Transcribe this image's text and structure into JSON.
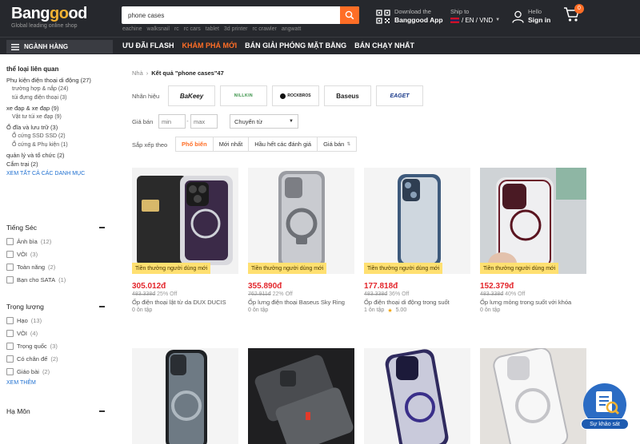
{
  "header": {
    "logo_main_a": "Bang",
    "logo_main_b": "go",
    "logo_main_c": "od",
    "logo_tagline": "Global leading online shop",
    "search_value": "phone cases",
    "hot_words": [
      "eachine",
      "walksnail",
      "rc",
      "rc cars",
      "tablet",
      "3d printer",
      "rc crawler",
      "angwatt"
    ],
    "app_line1": "Download the",
    "app_line2": "Banggood App",
    "ship_label": "Ship to",
    "ship_value": "/ EN / VND",
    "user_line1": "Hello",
    "user_line2": "Sign in",
    "cart_count": "0"
  },
  "nav": {
    "categories_label": "NGÀNH HÀNG",
    "links": [
      "ƯU ĐÃI FLASH",
      "KHÁM PHÁ MỚI",
      "BÁN GIẢI PHÓNG MẶT BẰNG",
      "BÁN CHẠY NHẤT"
    ]
  },
  "sidebar": {
    "related_title": "thể loại liên quan",
    "cat1": "Phụ kiện điện thoại di động (27)",
    "cat1_sub1": "trường hợp & nắp (24)",
    "cat1_sub2": "túi đựng điện thoại (3)",
    "cat2": "xe đạp & xe đạp (9)",
    "cat2_sub1": "Vật tư túi xe đạp (9)",
    "cat3": "Ổ đĩa và lưu trữ (3)",
    "cat3_sub1": "Ổ cứng SSD SSD (2)",
    "cat3_sub2": "Ổ cứng & Phụ kiện (1)",
    "cat4": "quản lý và tổ chức (2)",
    "cat5": "Cắm trại (2)",
    "see_all": "XEM TẤT CẢ CÁC DANH MỤC",
    "facet1_title": "Tiếng Séc",
    "facet1_items": [
      {
        "label": "Ảnh bìa",
        "count": "(12)"
      },
      {
        "label": "VÒI",
        "count": "(3)"
      },
      {
        "label": "Toàn năng",
        "count": "(2)"
      },
      {
        "label": "Bạn cho SATA",
        "count": "(1)"
      }
    ],
    "facet2_title": "Trọng lượng",
    "facet2_items": [
      {
        "label": "Hạo",
        "count": "(13)"
      },
      {
        "label": "VÒI",
        "count": "(4)"
      },
      {
        "label": "Trọng quốc",
        "count": "(3)"
      },
      {
        "label": "Có chân đế",
        "count": "(2)"
      },
      {
        "label": "Giáo bài",
        "count": "(2)"
      }
    ],
    "see_more": "XEM THÊM",
    "facet3_title": "Hạ Môn"
  },
  "main": {
    "crumb_home": "Nhà",
    "crumb_sep": "›",
    "crumb_current": "Kết quả \"phone cases\"47",
    "brand_label": "Nhãn hiệu",
    "brands": [
      "BaKeey",
      "NILLKIN",
      "ROCKBROS",
      "Baseus",
      "EAGET"
    ],
    "price_label": "Giá bán",
    "price_min_ph": "min",
    "price_max_ph": "max",
    "price_dash": "-",
    "convert_label": "Chuyển từ",
    "sort_label": "Sắp xếp theo",
    "sort_options": [
      "Phổ biến",
      "Mới nhất",
      "Hầu hết các đánh giá",
      "Giá bán"
    ]
  },
  "products": [
    {
      "promo": "Tiền thưởng người dùng mới",
      "price": "305.012đ",
      "old_price": "483.338đ",
      "discount": "25% Off",
      "name": "Ốp điện thoại lật từ da DUX DUCIS",
      "reviews": "0 ôn tập",
      "rating": ""
    },
    {
      "promo": "Tiền thưởng người dùng mới",
      "price": "355.890đ",
      "old_price": "762.911đ",
      "discount": "22% Off",
      "name": "Ốp lưng điện thoại Baseus Sky Ring",
      "reviews": "0 ôn tập",
      "rating": ""
    },
    {
      "promo": "Tiền thưởng người dùng mới",
      "price": "177.818đ",
      "old_price": "483.338đ",
      "discount": "36% Off",
      "name": "Ốp điện thoại di động trong suốt",
      "reviews": "1 ôn tập",
      "rating": "5.00"
    },
    {
      "promo": "Tiền thưởng người dùng mới",
      "price": "152.379đ",
      "old_price": "483.338đ",
      "discount": "40% Off",
      "name": "Ốp lưng mỏng trong suốt với khóa",
      "reviews": "0 ôn tập",
      "rating": ""
    }
  ],
  "survey_label": "Sự khảo sát",
  "colors": {
    "accent": "#ff6e26",
    "header_bg": "#26282d",
    "price_red": "#e3252b",
    "promo_yellow": "#ffe071"
  }
}
